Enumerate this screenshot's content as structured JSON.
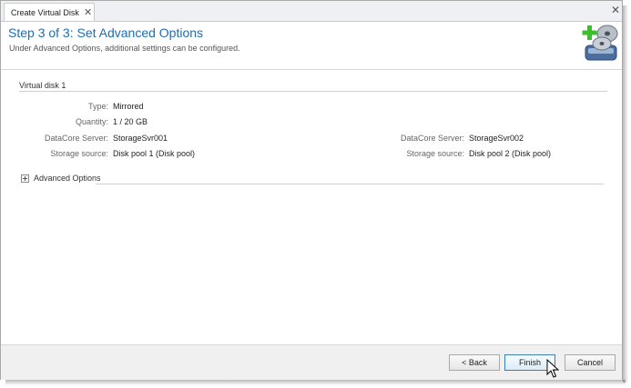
{
  "window": {
    "tab_title": "Create Virtual Disk",
    "tab_close_icon": "close-icon",
    "window_close_icon": "close-icon"
  },
  "header": {
    "title": "Step 3 of 3: Set Advanced Options",
    "subtitle": "Under Advanced Options, additional settings can be configured.",
    "icon": "add-virtual-disk-icon"
  },
  "virtual_disk": {
    "group_title": "Virtual disk 1",
    "type_label": "Type:",
    "type_value": "Mirrored",
    "quantity_label": "Quantity:",
    "quantity_value": "1 / 20 GB",
    "server_label": "DataCore Server:",
    "storage_label": "Storage source:",
    "left": {
      "server": "StorageSvr001",
      "storage": "Disk pool 1 (Disk pool)"
    },
    "right": {
      "server": "StorageSvr002",
      "storage": "Disk pool 2 (Disk pool)"
    }
  },
  "advanced": {
    "label": "Advanced Options",
    "expanded": false,
    "icon": "expand-plus-icon"
  },
  "footer": {
    "back_label": "< Back",
    "finish_label": "Finish",
    "cancel_label": "Cancel"
  },
  "colors": {
    "title_blue": "#1e6db5",
    "accent_green": "#3bbf2b"
  }
}
